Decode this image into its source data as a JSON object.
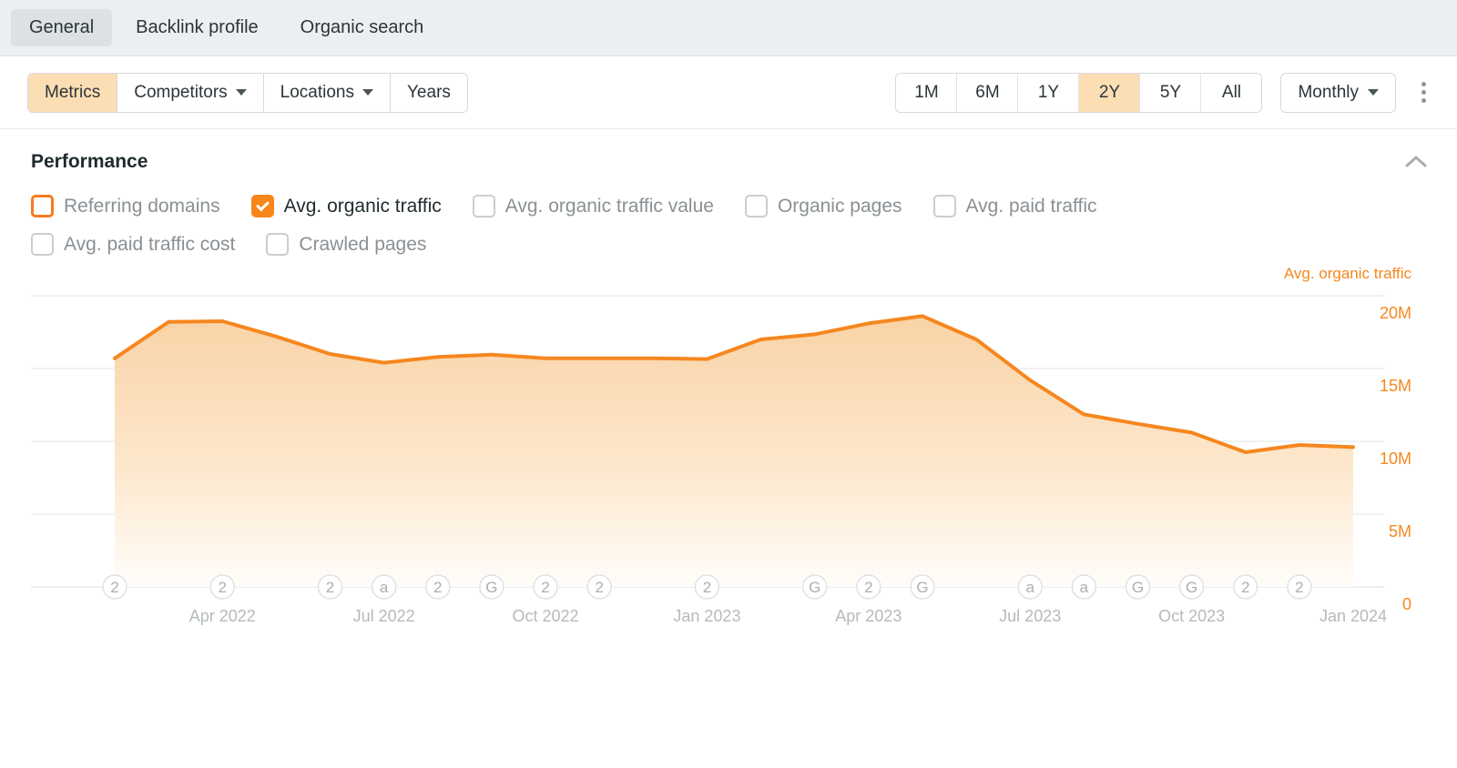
{
  "tabs": [
    {
      "label": "General",
      "active": true
    },
    {
      "label": "Backlink profile",
      "active": false
    },
    {
      "label": "Organic search",
      "active": false
    }
  ],
  "toolbar": {
    "left_buttons": [
      {
        "label": "Metrics",
        "selected": true,
        "has_caret": false
      },
      {
        "label": "Competitors",
        "selected": false,
        "has_caret": true
      },
      {
        "label": "Locations",
        "selected": false,
        "has_caret": true
      },
      {
        "label": "Years",
        "selected": false,
        "has_caret": false
      }
    ],
    "ranges": [
      {
        "label": "1M",
        "selected": false
      },
      {
        "label": "6M",
        "selected": false
      },
      {
        "label": "1Y",
        "selected": false
      },
      {
        "label": "2Y",
        "selected": true
      },
      {
        "label": "5Y",
        "selected": false
      },
      {
        "label": "All",
        "selected": false
      }
    ],
    "granularity": "Monthly",
    "more_icon": "kebab-menu-icon"
  },
  "panel": {
    "title": "Performance",
    "collapse_icon": "chevron-up-icon"
  },
  "metrics": [
    {
      "label": "Referring domains",
      "state": "ring",
      "row": 1
    },
    {
      "label": "Avg. organic traffic",
      "state": "checked",
      "row": 1
    },
    {
      "label": "Avg. organic traffic value",
      "state": "empty",
      "row": 1
    },
    {
      "label": "Organic pages",
      "state": "empty",
      "row": 1
    },
    {
      "label": "Avg. paid traffic",
      "state": "empty",
      "row": 1
    },
    {
      "label": "Avg. paid traffic cost",
      "state": "empty",
      "row": 2
    },
    {
      "label": "Crawled pages",
      "state": "empty",
      "row": 2
    }
  ],
  "colors": {
    "accent": "#f5871f",
    "line": "#f5871f",
    "area_top": "#fad9b0",
    "area_bottom": "#fffdfa",
    "selected_pill": "#fcdeb4",
    "tab_active_bg": "#dde1e5",
    "tabstrip_bg": "#eceff1",
    "grid": "#eceef0",
    "muted_text": "#8a9094",
    "axis_text": "#b4babd"
  },
  "chart_data": {
    "type": "area",
    "title": "Performance",
    "series_label": "Avg. organic traffic",
    "xlabel": "",
    "ylabel": "Avg. organic traffic",
    "ylim": [
      0,
      22222222
    ],
    "yticks": [
      0,
      5000000,
      10000000,
      15000000,
      20000000
    ],
    "ytick_labels": [
      "0",
      "5M",
      "10M",
      "15M",
      "20M"
    ],
    "grid": true,
    "legend_position": "top-right",
    "x_tick_labels": [
      "Apr 2022",
      "Jul 2022",
      "Oct 2022",
      "Jan 2023",
      "Apr 2023",
      "Jul 2023",
      "Oct 2023",
      "Jan 2024"
    ],
    "x_tick_indices": [
      2,
      5,
      8,
      11,
      14,
      17,
      20,
      23
    ],
    "x": [
      "Feb 2022",
      "Mar 2022",
      "Apr 2022",
      "May 2022",
      "Jun 2022",
      "Jul 2022",
      "Aug 2022",
      "Sep 2022",
      "Oct 2022",
      "Nov 2022",
      "Dec 2022",
      "Jan 2023",
      "Feb 2023",
      "Mar 2023",
      "Apr 2023",
      "May 2023",
      "Jun 2023",
      "Jul 2023",
      "Aug 2023",
      "Sep 2023",
      "Oct 2023",
      "Nov 2023",
      "Dec 2023",
      "Jan 2024"
    ],
    "values": [
      15700000,
      18200000,
      18250000,
      17200000,
      16000000,
      15400000,
      15800000,
      15950000,
      15700000,
      15700000,
      15700000,
      15650000,
      17000000,
      17350000,
      18100000,
      18600000,
      17000000,
      14200000,
      11850000,
      11200000,
      10600000,
      9250000,
      9750000,
      9600000
    ],
    "annotations": [
      {
        "index": 0,
        "glyph": "2"
      },
      {
        "index": 2,
        "glyph": "2"
      },
      {
        "index": 4,
        "glyph": "2"
      },
      {
        "index": 5,
        "glyph": "a"
      },
      {
        "index": 6,
        "glyph": "2"
      },
      {
        "index": 7,
        "glyph": "G"
      },
      {
        "index": 8,
        "glyph": "2"
      },
      {
        "index": 9,
        "glyph": "2"
      },
      {
        "index": 11,
        "glyph": "2"
      },
      {
        "index": 13,
        "glyph": "G"
      },
      {
        "index": 14,
        "glyph": "2"
      },
      {
        "index": 15,
        "glyph": "G"
      },
      {
        "index": 17,
        "glyph": "a"
      },
      {
        "index": 18,
        "glyph": "a"
      },
      {
        "index": 19,
        "glyph": "G"
      },
      {
        "index": 20,
        "glyph": "G"
      },
      {
        "index": 21,
        "glyph": "2"
      },
      {
        "index": 22,
        "glyph": "2"
      }
    ]
  }
}
